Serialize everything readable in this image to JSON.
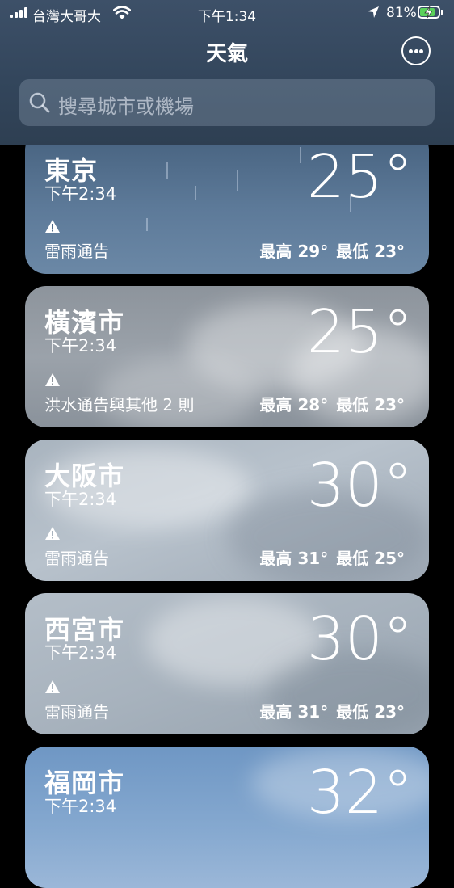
{
  "status_bar": {
    "carrier": "台灣大哥大",
    "time": "下午1:34",
    "battery": "81%"
  },
  "nav": {
    "title": "天氣",
    "more_icon": "ellipsis-circle-icon"
  },
  "search": {
    "placeholder": "搜尋城市或機場",
    "icon": "search-icon"
  },
  "cards": [
    {
      "city": "東京",
      "time": "下午2:34",
      "temp": "25°",
      "alert": "雷雨通告",
      "high": "最高 29°",
      "low": "最低 23°",
      "condition": "rain"
    },
    {
      "city": "橫濱市",
      "time": "下午2:34",
      "temp": "25°",
      "alert": "洪水通告與其他 2 則",
      "high": "最高 28°",
      "low": "最低 23°",
      "condition": "cloudy"
    },
    {
      "city": "大阪市",
      "time": "下午2:34",
      "temp": "30°",
      "alert": "雷雨通告",
      "high": "最高 31°",
      "low": "最低 25°",
      "condition": "cloudy"
    },
    {
      "city": "西宮市",
      "time": "下午2:34",
      "temp": "30°",
      "alert": "雷雨通告",
      "high": "最高 31°",
      "low": "最低 23°",
      "condition": "cloudy"
    },
    {
      "city": "福岡市",
      "time": "下午2:34",
      "temp": "32°",
      "condition": "partly-cloudy"
    }
  ],
  "colors": {
    "header_bg": "#33465c",
    "battery_fill": "#5ad15a",
    "card_rain_bg": "#5d7a99",
    "card_cloud_bg": "#9aa3ad"
  }
}
